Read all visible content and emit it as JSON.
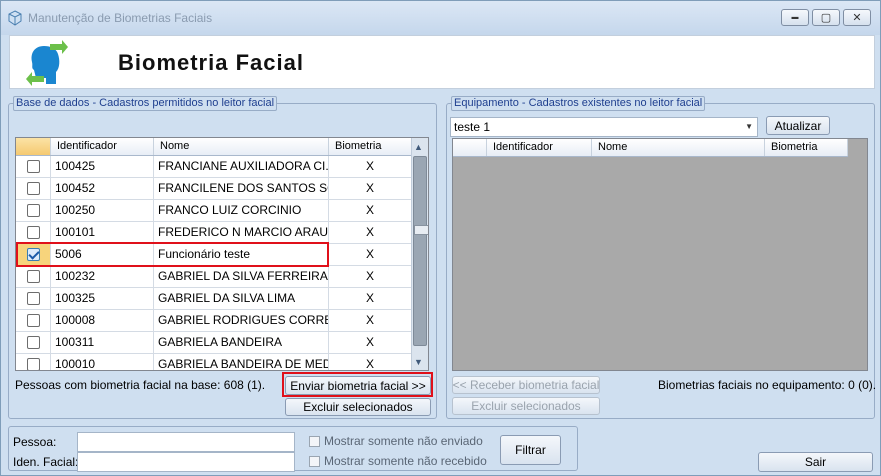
{
  "window": {
    "title": "Manutenção de Biometrias Faciais",
    "minimize": "▬",
    "maximize": "▢",
    "close": "✕"
  },
  "header": {
    "title": "Biometria Facial"
  },
  "left_panel": {
    "group_label": "Base de dados - Cadastros permitidos no leitor facial",
    "columns": [
      "",
      "Identificador",
      "Nome",
      "Biometria"
    ],
    "rows": [
      {
        "checked": false,
        "id": "100425",
        "name": "FRANCIANE AUXILIADORA  CI...",
        "bio": "X"
      },
      {
        "checked": false,
        "id": "100452",
        "name": "FRANCILENE DOS SANTOS SO...",
        "bio": "X"
      },
      {
        "checked": false,
        "id": "100250",
        "name": "FRANCO LUIZ CORCINIO",
        "bio": "X"
      },
      {
        "checked": false,
        "id": "100101",
        "name": "FREDERICO N MARCIO ARAUJO",
        "bio": "X"
      },
      {
        "checked": true,
        "id": "5006",
        "name": "Funcionário teste",
        "bio": "X"
      },
      {
        "checked": false,
        "id": "100232",
        "name": "GABRIEL DA SILVA FERREIRA",
        "bio": "X"
      },
      {
        "checked": false,
        "id": "100325",
        "name": "GABRIEL DA SILVA LIMA",
        "bio": "X"
      },
      {
        "checked": false,
        "id": "100008",
        "name": "GABRIEL RODRIGUES CORREIA",
        "bio": "X"
      },
      {
        "checked": false,
        "id": "100311",
        "name": "GABRIELA BANDEIRA",
        "bio": "X"
      },
      {
        "checked": false,
        "id": "100010",
        "name": "GABRIELA BANDEIRA DE MED...",
        "bio": "X"
      }
    ],
    "count_label": "Pessoas com biometria facial na base:  608 (1).",
    "send_button": "Enviar biometria facial >>",
    "delete_button": "Excluir selecionados"
  },
  "right_panel": {
    "group_label": "Equipamento - Cadastros existentes no leitor facial",
    "device_select": "teste 1",
    "refresh_button": "Atualizar",
    "columns": [
      "",
      "Identificador",
      "Nome",
      "Biometria"
    ],
    "receive_button": "<< Receber biometria facial",
    "delete_button": "Excluir selecionados",
    "count_label": "Biometrias faciais no equipamento: 0 (0)."
  },
  "filter": {
    "person_label": "Pessoa:",
    "person_value": "",
    "facial_id_label": "Iden. Facial:",
    "facial_id_value": "",
    "only_not_sent": "Mostrar somente não enviado",
    "only_not_received": "Mostrar somente não recebido",
    "filter_button": "Filtrar"
  },
  "exit_button": "Sair",
  "colors": {
    "highlight": "#e0101a",
    "group_label": "#1f3f8f",
    "empty_grid": "#a9a9a9"
  }
}
